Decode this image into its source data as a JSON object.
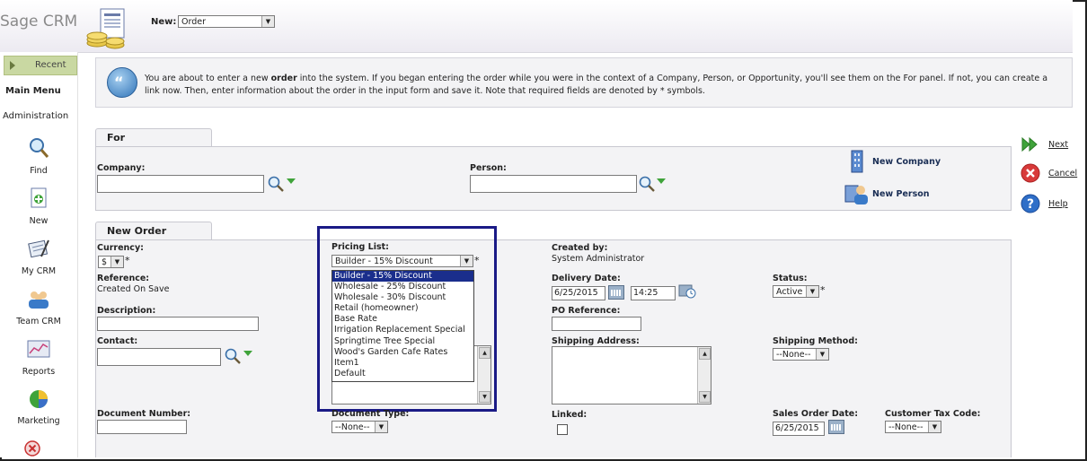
{
  "header": {
    "logo": "Sage CRM",
    "new_label": "New:",
    "new_value": "Order"
  },
  "sidebar": {
    "recent": "Recent",
    "main_menu": "Main Menu",
    "administration": "Administration",
    "items": [
      {
        "label": "Find",
        "icon": "magnifier-icon"
      },
      {
        "label": "New",
        "icon": "new-document-icon"
      },
      {
        "label": "My CRM",
        "icon": "my-crm-icon"
      },
      {
        "label": "Team CRM",
        "icon": "team-icon"
      },
      {
        "label": "Reports",
        "icon": "reports-icon"
      },
      {
        "label": "Marketing",
        "icon": "pie-chart-icon"
      }
    ]
  },
  "info": {
    "text_before": "You are about to enter a new ",
    "bold_word": "order",
    "text_after": " into the system. If you began entering the order while you were in the context of a Company, Person, or Opportunity, you'll see them on the For panel. If not, you can create a link now. Then, enter information about the order in the input form and save it. Note that required fields are denoted by * symbols."
  },
  "for_panel": {
    "tab": "For",
    "company_label": "Company:",
    "person_label": "Person:",
    "new_company": "New Company",
    "new_person": "New Person"
  },
  "actions": {
    "next": "Next",
    "cancel": "Cancel",
    "help": "Help"
  },
  "order_panel": {
    "tab": "New Order",
    "currency_label": "Currency:",
    "currency_value": "$",
    "reference_label": "Reference:",
    "reference_value": "Created On Save",
    "description_label": "Description:",
    "contact_label": "Contact:",
    "document_number_label": "Document Number:",
    "pricing_list_label": "Pricing List:",
    "pricing_list_value": "Builder - 15% Discount",
    "pricing_list_options": [
      "Builder - 15% Discount",
      "Wholesale - 25% Discount",
      "Wholesale - 30% Discount",
      "Retail (homeowner)",
      "Base Rate",
      "Irrigation Replacement Special",
      "Springtime Tree Special",
      "Wood's Garden Cafe Rates",
      "Item1",
      "Default"
    ],
    "document_type_label": "Document Type:",
    "document_type_value": "--None--",
    "created_by_label": "Created by:",
    "created_by_value": "System Administrator",
    "delivery_date_label": "Delivery Date:",
    "delivery_date_value": "6/25/2015",
    "delivery_time_value": "14:25",
    "po_reference_label": "PO Reference:",
    "shipping_address_label": "Shipping Address:",
    "linked_label": "Linked:",
    "status_label": "Status:",
    "status_value": "Active",
    "shipping_method_label": "Shipping Method:",
    "shipping_method_value": "--None--",
    "sales_order_date_label": "Sales Order Date:",
    "sales_order_date_value": "6/25/2015",
    "customer_tax_code_label": "Customer Tax Code:",
    "customer_tax_code_value": "--None--",
    "required_mark": "*"
  },
  "colors": {
    "highlight_border": "#1a1a86",
    "selected_option": "#1a2e8c",
    "recent_bg": "#c9d8a2",
    "panel_bg": "#f3f3f5"
  }
}
